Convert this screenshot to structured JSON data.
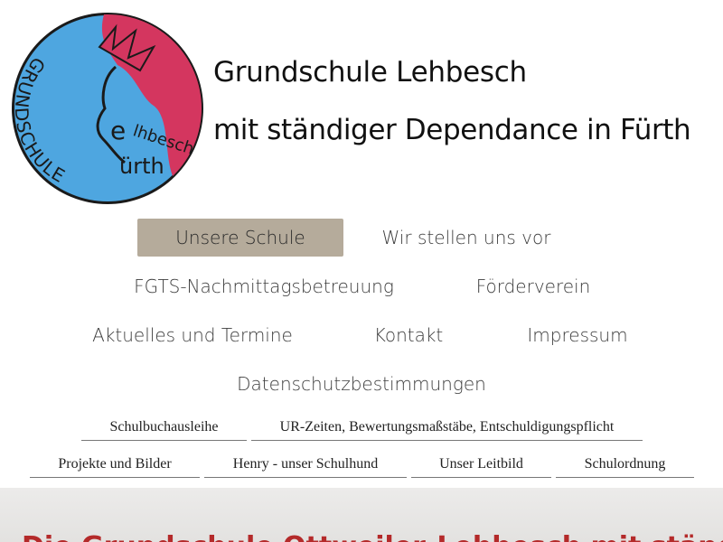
{
  "header": {
    "logo_text_arc": "GRUNDSCHULE",
    "logo_text_e": "e",
    "logo_text_lehbesch": "lhbesch",
    "logo_text_fuerth": "ürth",
    "title": "Grundschule Lehbesch",
    "subtitle": "mit ständiger Dependance in Fürth"
  },
  "colors": {
    "logo_blue": "#4ea6e0",
    "logo_red": "#d4365f",
    "nav_active_bg": "#b5ab9b",
    "banner_text": "#b42a2a"
  },
  "nav": {
    "unsere_schule": "Unsere Schule",
    "wir_stellen_uns_vor": "Wir stellen uns vor",
    "fgts": "FGTS-Nachmittagsbetreuung",
    "foerderverein": "Förderverein",
    "aktuelles": "Aktuelles und Termine",
    "kontakt": "Kontakt",
    "impressum": "Impressum",
    "datenschutz": "Datenschutzbestimmungen"
  },
  "subnav": {
    "schulbuch": "Schulbuchausleihe",
    "ur_zeiten": "UR-Zeiten, Bewertungsmaßstäbe, Entschuldigungspflicht",
    "projekte": "Projekte und Bilder",
    "henry": "Henry - unser Schulhund",
    "leitbild": "Unser Leitbild",
    "schulordnung": "Schulordnung"
  },
  "banner": {
    "text": "Die Grundschule Ottweiler-Lehbesch mit ständiger Dependance"
  }
}
